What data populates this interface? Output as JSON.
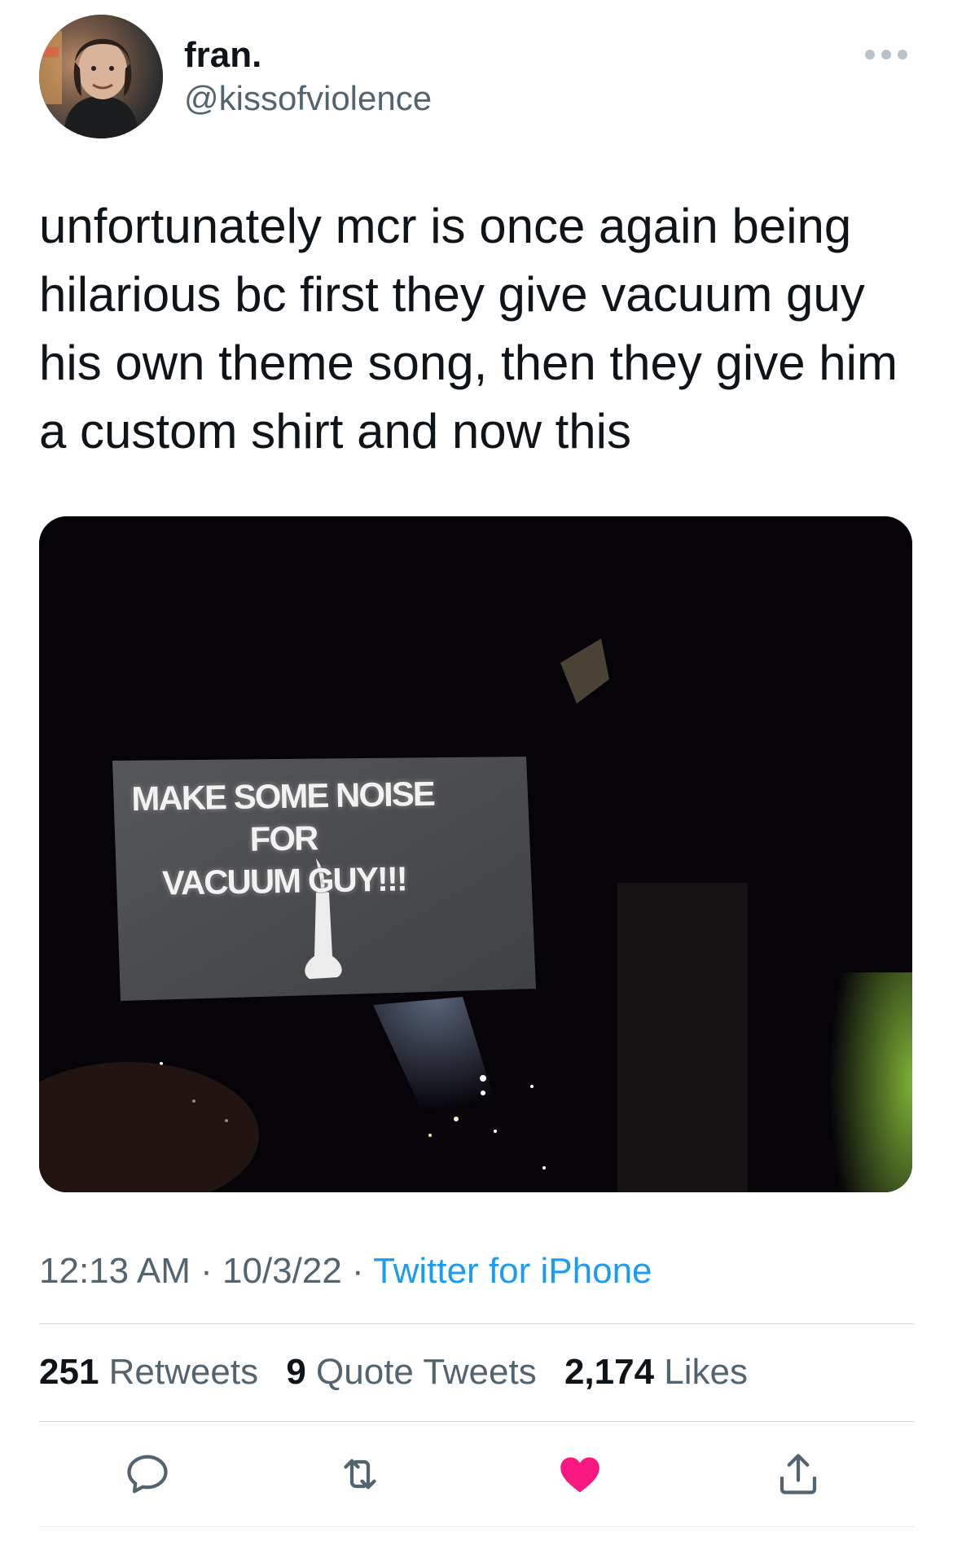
{
  "author": {
    "display_name": "fran.",
    "handle": "@kissofviolence"
  },
  "tweet": {
    "text": "unfortunately mcr is once again being hilarious bc first they give vacuum guy his own theme song, then they give him a custom shirt and now this",
    "media": {
      "sign_line1": "MAKE SOME NOISE FOR",
      "sign_line2": "VACUUM GUY!!!"
    }
  },
  "meta": {
    "time": "12:13 AM",
    "separator": " · ",
    "date": "10/3/22",
    "source": "Twitter for iPhone"
  },
  "stats": {
    "retweets_count": "251",
    "retweets_label": "Retweets",
    "quotes_count": "9",
    "quotes_label": "Quote Tweets",
    "likes_count": "2,174",
    "likes_label": "Likes"
  },
  "actions": {
    "reply_icon": "reply-icon",
    "retweet_icon": "retweet-icon",
    "like_icon": "heart-icon",
    "share_icon": "share-icon",
    "liked": true,
    "like_color": "#f91880",
    "icon_color": "#536471",
    "link_color": "#1d9bf0"
  }
}
